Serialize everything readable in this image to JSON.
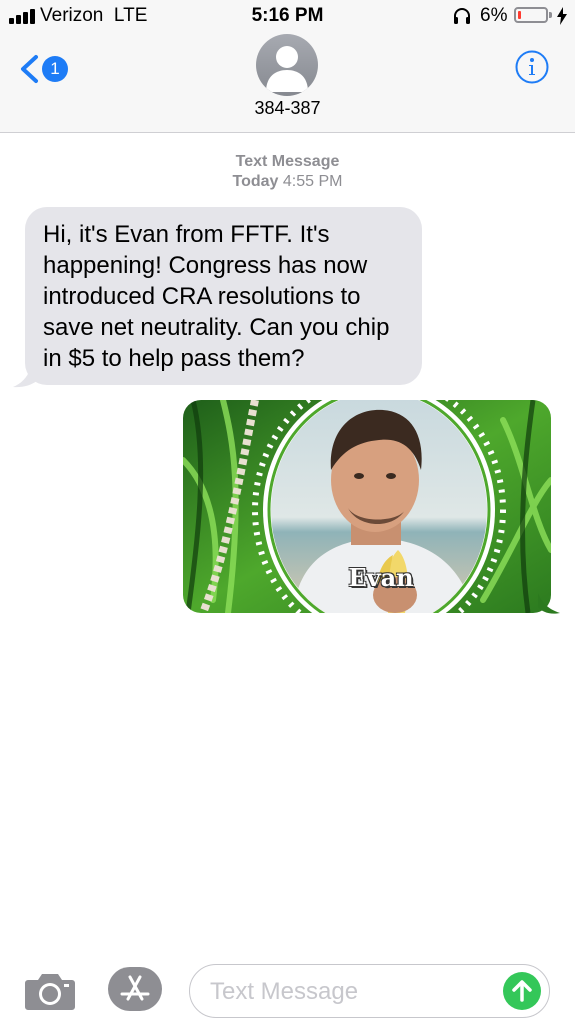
{
  "status_bar": {
    "carrier": "Verizon  LTE",
    "time": "5:16 PM",
    "battery_percent": "6%",
    "battery_level": 0.06,
    "icons": [
      "signal-icon",
      "headphones-icon",
      "battery-icon",
      "charging-bolt-icon"
    ]
  },
  "header": {
    "back_badge": "1",
    "contact": "384-387",
    "icons": [
      "chevron-left-icon",
      "avatar-icon",
      "info-icon"
    ]
  },
  "conversation": {
    "service_label": "Text Message",
    "day_label": "Today",
    "time_label": "4:55 PM",
    "incoming_message": "Hi, it's Evan from FFTF.  It's happening! Congress has now introduced CRA resolutions to save net neutrality. Can you chip in $5 to help pass them?",
    "gif_caption": "Evan"
  },
  "input_bar": {
    "placeholder": "Text Message",
    "icons": [
      "camera-icon",
      "app-store-icon",
      "send-arrow-icon"
    ]
  },
  "colors": {
    "ios_blue": "#1e7cf6",
    "incoming_bubble": "#e5e5ea",
    "send_green": "#34c759",
    "battery_low": "#ff3b30",
    "secondary_text": "#8e8e93"
  }
}
